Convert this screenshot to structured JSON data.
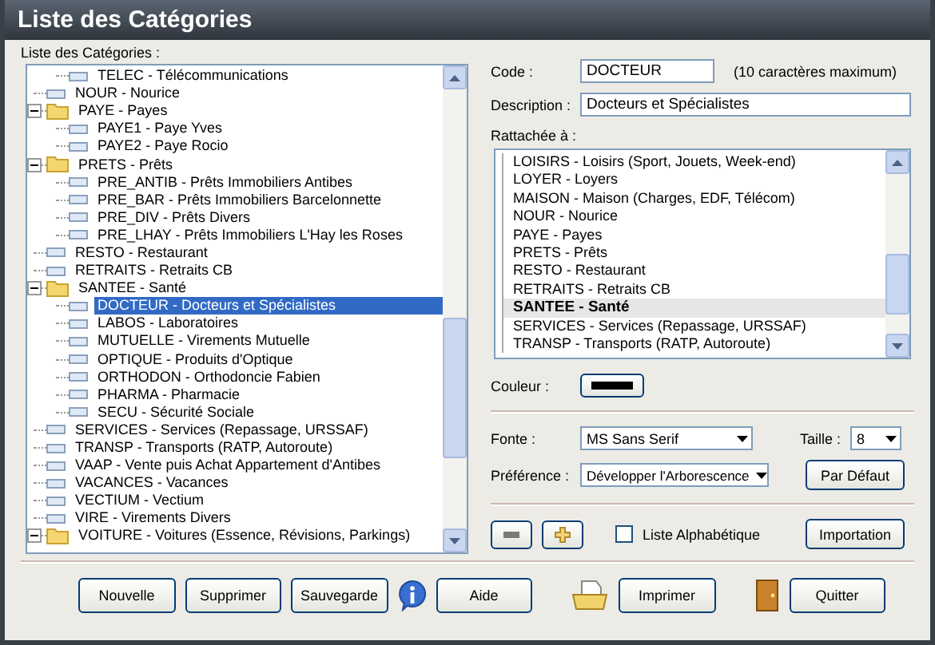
{
  "window": {
    "title": "Liste des Catégories"
  },
  "tree": {
    "label": "Liste des Catégories :",
    "items": [
      {
        "children": [
          {
            "label": "TELEC - Télécommunications",
            "selected": false
          }
        ]
      },
      {
        "label": "NOUR - Nourice",
        "selected": false
      },
      {
        "label": "PAYE - Payes",
        "expanded": true,
        "selected": false,
        "children": [
          {
            "label": "PAYE1 - Paye Yves",
            "selected": false
          },
          {
            "label": "PAYE2 - Paye Rocio",
            "selected": false
          }
        ]
      },
      {
        "label": "PRETS - Prêts",
        "expanded": true,
        "selected": false,
        "children": [
          {
            "label": "PRE_ANTIB - Prêts Immobiliers Antibes",
            "selected": false
          },
          {
            "label": "PRE_BAR - Prêts Immobiliers Barcelonnette",
            "selected": false
          },
          {
            "label": "PRE_DIV - Prêts Divers",
            "selected": false
          },
          {
            "label": "PRE_LHAY - Prêts Immobiliers L'Hay les Roses",
            "selected": false
          }
        ]
      },
      {
        "label": "RESTO - Restaurant",
        "selected": false
      },
      {
        "label": "RETRAITS - Retraits CB",
        "selected": false
      },
      {
        "label": "SANTEE - Santé",
        "expanded": true,
        "selected": false,
        "children": [
          {
            "label": "DOCTEUR - Docteurs et Spécialistes",
            "selected": true
          },
          {
            "label": "LABOS - Laboratoires",
            "selected": false
          },
          {
            "label": "MUTUELLE - Virements Mutuelle",
            "selected": false
          },
          {
            "label": "OPTIQUE - Produits d'Optique",
            "selected": false
          },
          {
            "label": "ORTHODON - Orthodoncie Fabien",
            "selected": false
          },
          {
            "label": "PHARMA - Pharmacie",
            "selected": false
          },
          {
            "label": "SECU - Sécurité Sociale",
            "selected": false
          }
        ]
      },
      {
        "label": "SERVICES - Services (Repassage, URSSAF)",
        "selected": false
      },
      {
        "label": "TRANSP - Transports (RATP, Autoroute)",
        "selected": false
      },
      {
        "label": "VAAP - Vente puis Achat Appartement d'Antibes",
        "selected": false
      },
      {
        "label": "VACANCES - Vacances",
        "selected": false
      },
      {
        "label": "VECTIUM - Vectium",
        "selected": false
      },
      {
        "label": "VIRE - Virements Divers",
        "selected": false
      },
      {
        "label": "VOITURE - Voitures (Essence, Révisions, Parkings)",
        "expanded": true,
        "selected": false
      }
    ]
  },
  "code": {
    "label": "Code :",
    "value": "DOCTEUR",
    "hint": "(10 caractères maximum)"
  },
  "description": {
    "label": "Description :",
    "value": "Docteurs et Spécialistes"
  },
  "parent_list": {
    "label": "Rattachée à :",
    "items": [
      {
        "label": "LOISIRS - Loisirs (Sport, Jouets, Week-end)",
        "selected": false
      },
      {
        "label": "LOYER - Loyers",
        "selected": false
      },
      {
        "label": "MAISON - Maison (Charges, EDF, Télécom)",
        "selected": false
      },
      {
        "label": "NOUR - Nourice",
        "selected": false
      },
      {
        "label": "PAYE - Payes",
        "selected": false
      },
      {
        "label": "PRETS - Prêts",
        "selected": false
      },
      {
        "label": "RESTO - Restaurant",
        "selected": false
      },
      {
        "label": "RETRAITS - Retraits CB",
        "selected": false
      },
      {
        "label": "SANTEE - Santé",
        "selected": true
      },
      {
        "label": "SERVICES - Services (Repassage, URSSAF)",
        "selected": false
      },
      {
        "label": "TRANSP - Transports (RATP, Autoroute)",
        "selected": false
      }
    ]
  },
  "color": {
    "label": "Couleur :",
    "color": "#000000"
  },
  "font": {
    "label": "Fonte :",
    "value": "MS Sans Serif"
  },
  "size": {
    "label": "Taille :",
    "value": "8"
  },
  "preference": {
    "label": "Préférence :",
    "value": "Développer l'Arborescence"
  },
  "default_button": "Par Défaut",
  "alphabetical": {
    "label": "Liste Alphabétique",
    "checked": false
  },
  "import_button": "Importation",
  "buttons": [
    {
      "label": "Nouvelle",
      "kind": "plain"
    },
    {
      "label": "Supprimer",
      "kind": "plain"
    },
    {
      "label": "Sauvegarde",
      "kind": "plain"
    },
    {
      "label": "Aide",
      "kind": "info"
    },
    {
      "label": "Imprimer",
      "kind": "print"
    },
    {
      "label": "Quitter",
      "kind": "exit"
    }
  ]
}
